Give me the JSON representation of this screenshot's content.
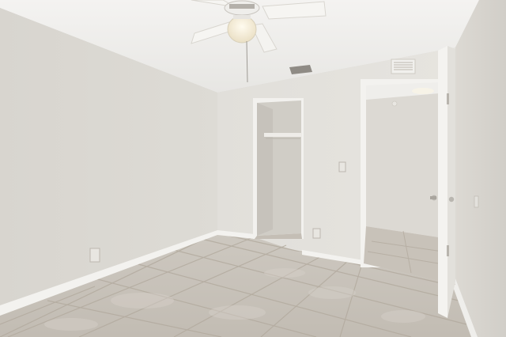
{
  "scene": {
    "subject": "empty-bedroom-interior",
    "colors": {
      "ceiling": "#efeeec",
      "left_wall": "#d6d3cd",
      "back_wall": "#e4e2dd",
      "right_wall": "#d3d1cb",
      "closet_interior": "#cfccc5",
      "floor_tile": "#c9c3bb",
      "grout": "#b7b0a6",
      "baseboard": "#f2f1ee",
      "door": "#f3f2ef",
      "fan_light": "#f7f1df"
    }
  }
}
